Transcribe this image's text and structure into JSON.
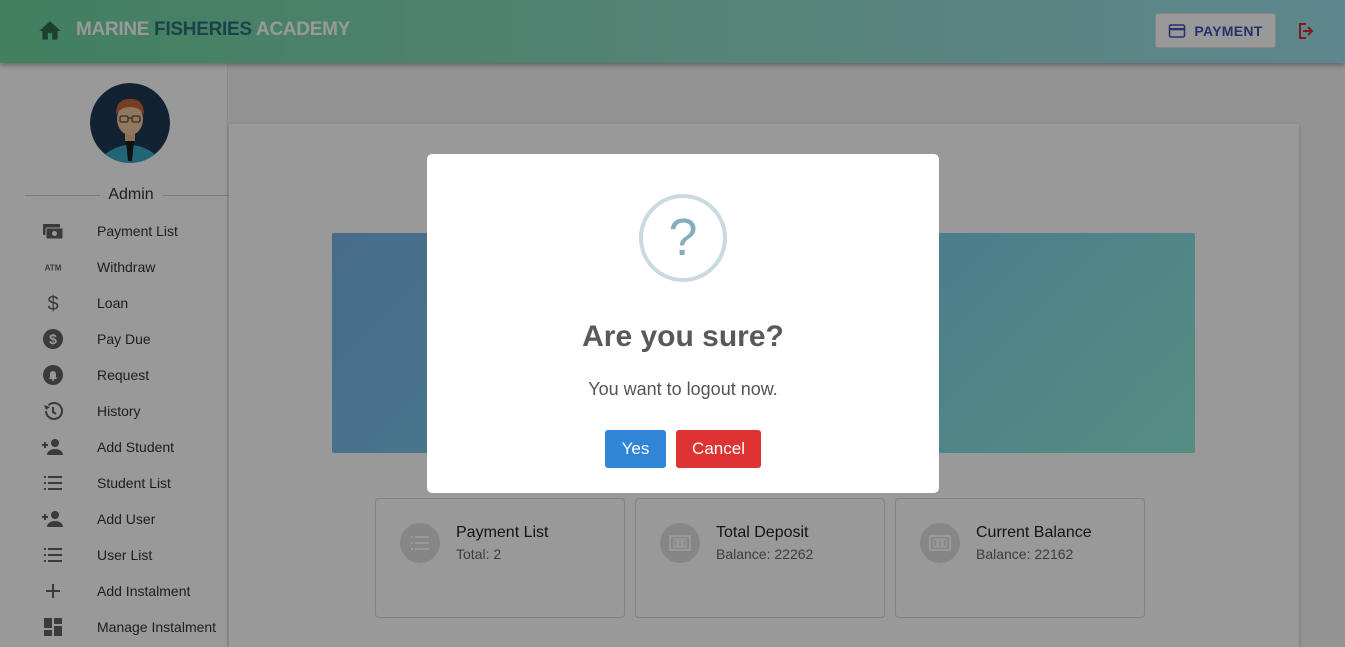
{
  "header": {
    "brand_part1": "MARINE",
    "brand_part2": "FISHERIES",
    "brand_part3": "ACADEMY",
    "payment_label": "PAYMENT",
    "home_icon": "home-icon",
    "logout_icon": "logout-icon",
    "brand_accent_color": "#2c6e78"
  },
  "sidebar": {
    "user_role": "Admin",
    "items": [
      {
        "label": "Payment List",
        "icon": "payments-icon"
      },
      {
        "label": "Withdraw",
        "icon": "atm-icon"
      },
      {
        "label": "Loan",
        "icon": "dollar-icon"
      },
      {
        "label": "Pay Due",
        "icon": "monetization-icon"
      },
      {
        "label": "Request",
        "icon": "bell-icon"
      },
      {
        "label": "History",
        "icon": "history-icon"
      },
      {
        "label": "Add Student",
        "icon": "person-add-icon"
      },
      {
        "label": "Student List",
        "icon": "list-icon"
      },
      {
        "label": "Add User",
        "icon": "person-add-icon"
      },
      {
        "label": "User List",
        "icon": "list-icon"
      },
      {
        "label": "Add Instalment",
        "icon": "plus-icon"
      },
      {
        "label": "Manage Instalment",
        "icon": "dashboard-icon"
      }
    ]
  },
  "stats": [
    {
      "title": "Payment List",
      "sub": "Total: 2",
      "icon": "list-icon"
    },
    {
      "title": "Total Deposit",
      "sub": "Balance: 22262",
      "icon": "money-icon"
    },
    {
      "title": "Current Balance",
      "sub": "Balance: 22162",
      "icon": "money-icon"
    }
  ],
  "dialog": {
    "icon_glyph": "?",
    "title": "Are you sure?",
    "message": "You want to logout now.",
    "confirm_label": "Yes",
    "cancel_label": "Cancel",
    "confirm_color": "#3085d6",
    "cancel_color": "#dd3333"
  }
}
